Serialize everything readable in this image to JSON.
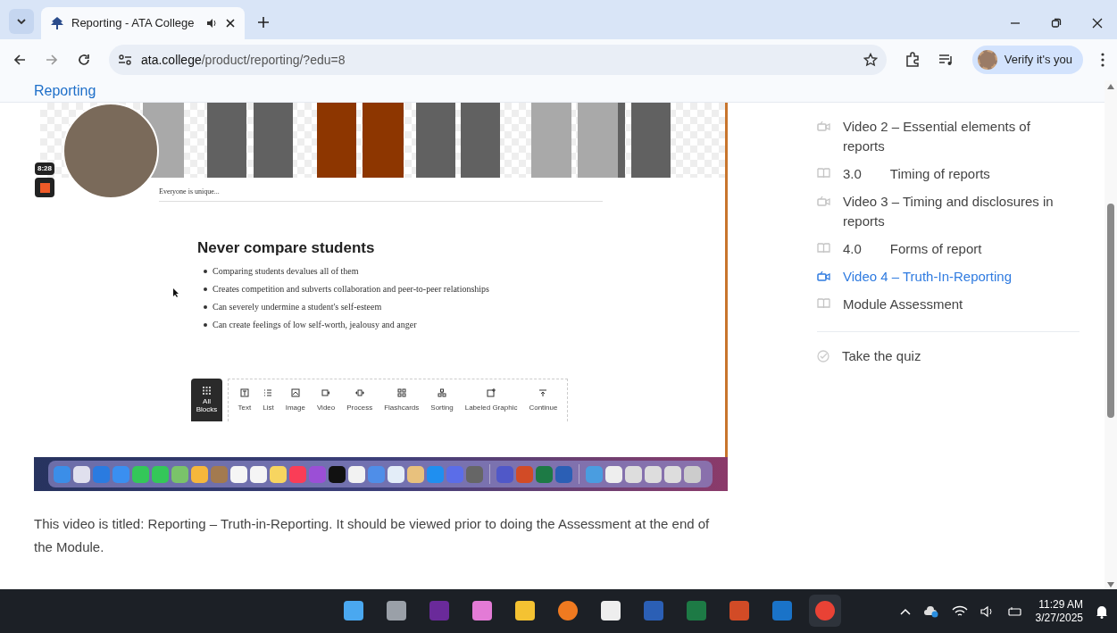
{
  "browser": {
    "tab": {
      "title": "Reporting - ATA College"
    },
    "address": {
      "host": "ata.college",
      "path": "/product/reporting/?edu=8"
    },
    "profile_button": "Verify it's you"
  },
  "page_header": {
    "title": "Reporting"
  },
  "video": {
    "timer": "8:28",
    "caption": "Everyone is unique...",
    "heading": "Never compare students",
    "bullets": [
      "Comparing students devalues all of them",
      "Creates competition and subverts collaboration and peer-to-peer relationships",
      "Can severely undermine a student's self-esteem",
      "Can create feelings of low self-worth, jealousy and anger"
    ],
    "all_blocks": "All Blocks",
    "blocks": [
      {
        "label": "Text"
      },
      {
        "label": "List"
      },
      {
        "label": "Image"
      },
      {
        "label": "Video"
      },
      {
        "label": "Process"
      },
      {
        "label": "Flashcards"
      },
      {
        "label": "Sorting"
      },
      {
        "label": "Labeled Graphic"
      },
      {
        "label": "Continue"
      }
    ]
  },
  "description": "This video is titled: Reporting – Truth-in-Reporting. It should be viewed prior to doing the Assessment at the end of the Module.",
  "lesson_list": {
    "items": [
      {
        "kind": "video",
        "title": "Video 2 – Essential elements of reports",
        "selected": false
      },
      {
        "kind": "lesson",
        "number": "3.0",
        "title": "Timing of reports",
        "selected": false
      },
      {
        "kind": "video",
        "title": "Video 3 – Timing and disclosures in reports",
        "selected": false
      },
      {
        "kind": "lesson",
        "number": "4.0",
        "title": "Forms of report",
        "selected": false
      },
      {
        "kind": "video",
        "title": "Video 4 – Truth-In-Reporting",
        "selected": true
      },
      {
        "kind": "lesson",
        "title": "Module Assessment",
        "selected": false
      }
    ],
    "quiz": {
      "label": "Take the quiz"
    }
  },
  "taskbar": {
    "time": "11:29 AM",
    "date": "3/27/2025"
  }
}
